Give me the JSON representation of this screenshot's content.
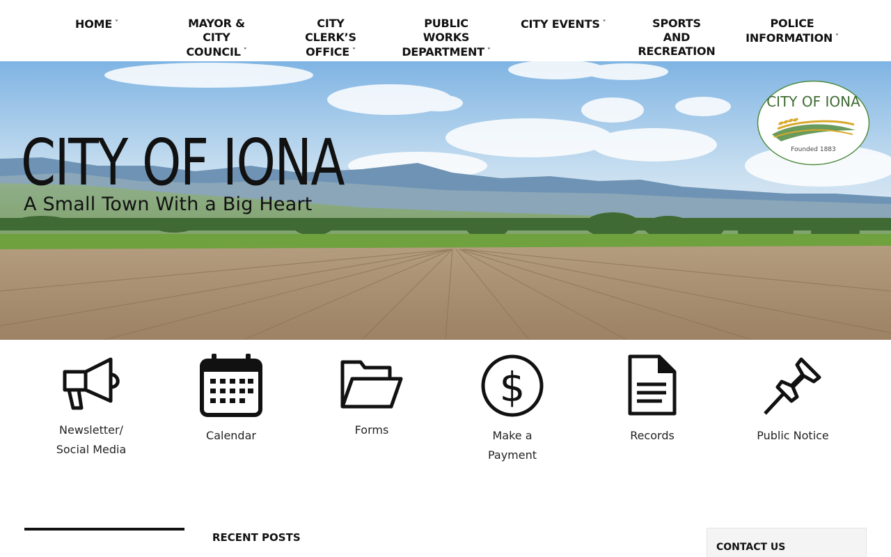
{
  "nav": {
    "items": [
      {
        "label": "HOME",
        "chevron": true
      },
      {
        "label": "MAYOR & CITY\nCOUNCIL",
        "chevron": true
      },
      {
        "label": "CITY CLERK’S\nOFFICE",
        "chevron": true
      },
      {
        "label": "PUBLIC WORKS\nDEPARTMENT",
        "chevron": true
      },
      {
        "label": "CITY EVENTS",
        "chevron": true
      },
      {
        "label": "SPORTS AND\nRECREATION",
        "chevron": false
      },
      {
        "label": "POLICE\nINFORMATION",
        "chevron": true
      }
    ],
    "chevron_glyph": "˅"
  },
  "hero": {
    "title": "CITY OF IONA",
    "tagline": "A Small Town With a Big Heart",
    "seal": {
      "name": "CITY OF IONA",
      "founded": "Founded 1883"
    }
  },
  "quick_links": [
    {
      "label": "Newsletter/ Social Media",
      "icon": "megaphone-icon"
    },
    {
      "label": "Calendar",
      "icon": "calendar-icon"
    },
    {
      "label": "Forms",
      "icon": "folder-open-icon"
    },
    {
      "label": "Make a Payment",
      "icon": "dollar-circle-icon"
    },
    {
      "label": "Records",
      "icon": "document-icon"
    },
    {
      "label": "Public Notice",
      "icon": "pushpin-icon"
    }
  ],
  "sections": {
    "recent_posts": "RECENT POSTS",
    "contact_us": "CONTACT US"
  },
  "colors": {
    "sky": "#9cc7ea",
    "mountain": "#5f86a6",
    "field_green": "#6fa13e",
    "soil": "#a58a6a",
    "seal_green": "#4f8a3f",
    "seal_gold": "#d9a92b"
  }
}
